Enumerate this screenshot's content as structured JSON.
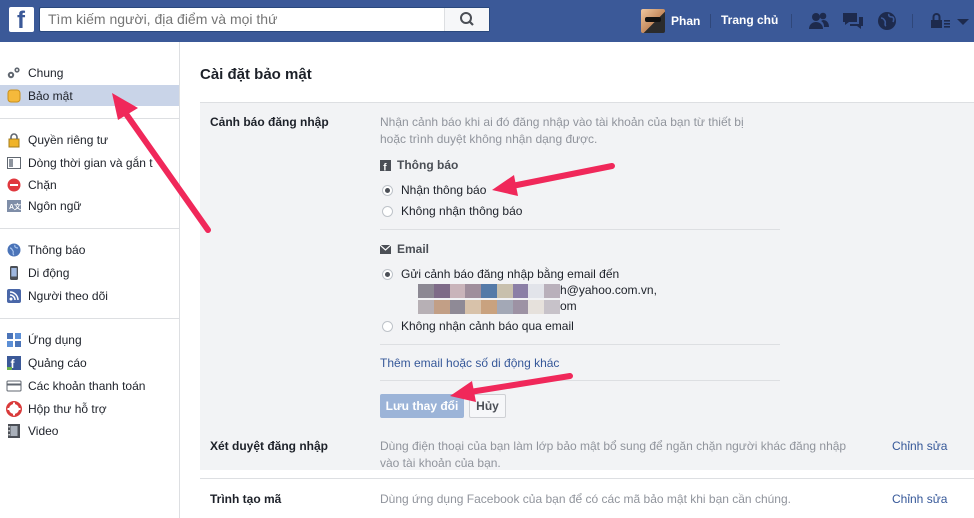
{
  "header": {
    "logo": "f",
    "search_placeholder": "Tìm kiếm người, địa điểm và mọi thứ",
    "user_name": "Phan",
    "home_label": "Trang chủ"
  },
  "sidebar": {
    "group1": [
      {
        "label": "Chung",
        "icon": "gears-icon"
      },
      {
        "label": "Bảo mật",
        "icon": "shield-badge-icon",
        "active": true
      }
    ],
    "group2": [
      {
        "label": "Quyền riêng tư",
        "icon": "lock-icon"
      },
      {
        "label": "Dòng thời gian và gắn t",
        "icon": "timeline-icon"
      },
      {
        "label": "Chặn",
        "icon": "block-icon"
      },
      {
        "label": "Ngôn ngữ",
        "icon": "language-icon"
      }
    ],
    "group3": [
      {
        "label": "Thông báo",
        "icon": "globe-icon"
      },
      {
        "label": "Di động",
        "icon": "mobile-icon"
      },
      {
        "label": "Người theo dõi",
        "icon": "rss-icon"
      }
    ],
    "group4": [
      {
        "label": "Ứng dụng",
        "icon": "apps-icon"
      },
      {
        "label": "Quảng cáo",
        "icon": "ads-icon"
      },
      {
        "label": "Các khoản thanh toán",
        "icon": "card-icon"
      },
      {
        "label": "Hộp thư hỗ trợ",
        "icon": "lifebuoy-icon"
      },
      {
        "label": "Video",
        "icon": "film-icon"
      }
    ]
  },
  "main": {
    "title": "Cài đặt bảo mật",
    "login_alerts": {
      "label": "Cảnh báo đăng nhập",
      "description_line1": "Nhận cảnh báo khi ai đó đăng nhập vào tài khoản của bạn từ thiết bị",
      "description_line2": "hoặc trình duyệt không nhận dạng được.",
      "notifications_heading": "Thông báo",
      "notify_on": "Nhận thông báo",
      "notify_off": "Không nhận thông báo",
      "email_heading": "Email",
      "email_on": "Gửi cảnh báo đăng nhập bằng email đến",
      "email_addr_1_suffix": "h@yahoo.com.vn,",
      "email_addr_2_suffix": "om",
      "email_off": "Không nhận cảnh báo qua email",
      "add_contact_link": "Thêm email hoặc số di động khác",
      "save_button": "Lưu thay đổi",
      "cancel_button": "Hủy"
    },
    "login_approvals": {
      "label": "Xét duyệt đăng nhập",
      "description_line1": "Dùng điện thoại của bạn làm lớp bảo mật bổ sung để ngăn chặn người khác đăng nhập",
      "description_line2": "vào tài khoản của bạn.",
      "edit": "Chỉnh sửa"
    },
    "code_generator": {
      "label": "Trình tạo mã",
      "description": "Dùng ứng dụng Facebook của bạn để có các mã bảo mật khi bạn cần chúng.",
      "edit": "Chỉnh sửa"
    }
  },
  "colors": {
    "brand": "#3b5998",
    "annotation_arrow": "#f0285a",
    "section_bg": "#f2f3f5",
    "link": "#365899"
  }
}
